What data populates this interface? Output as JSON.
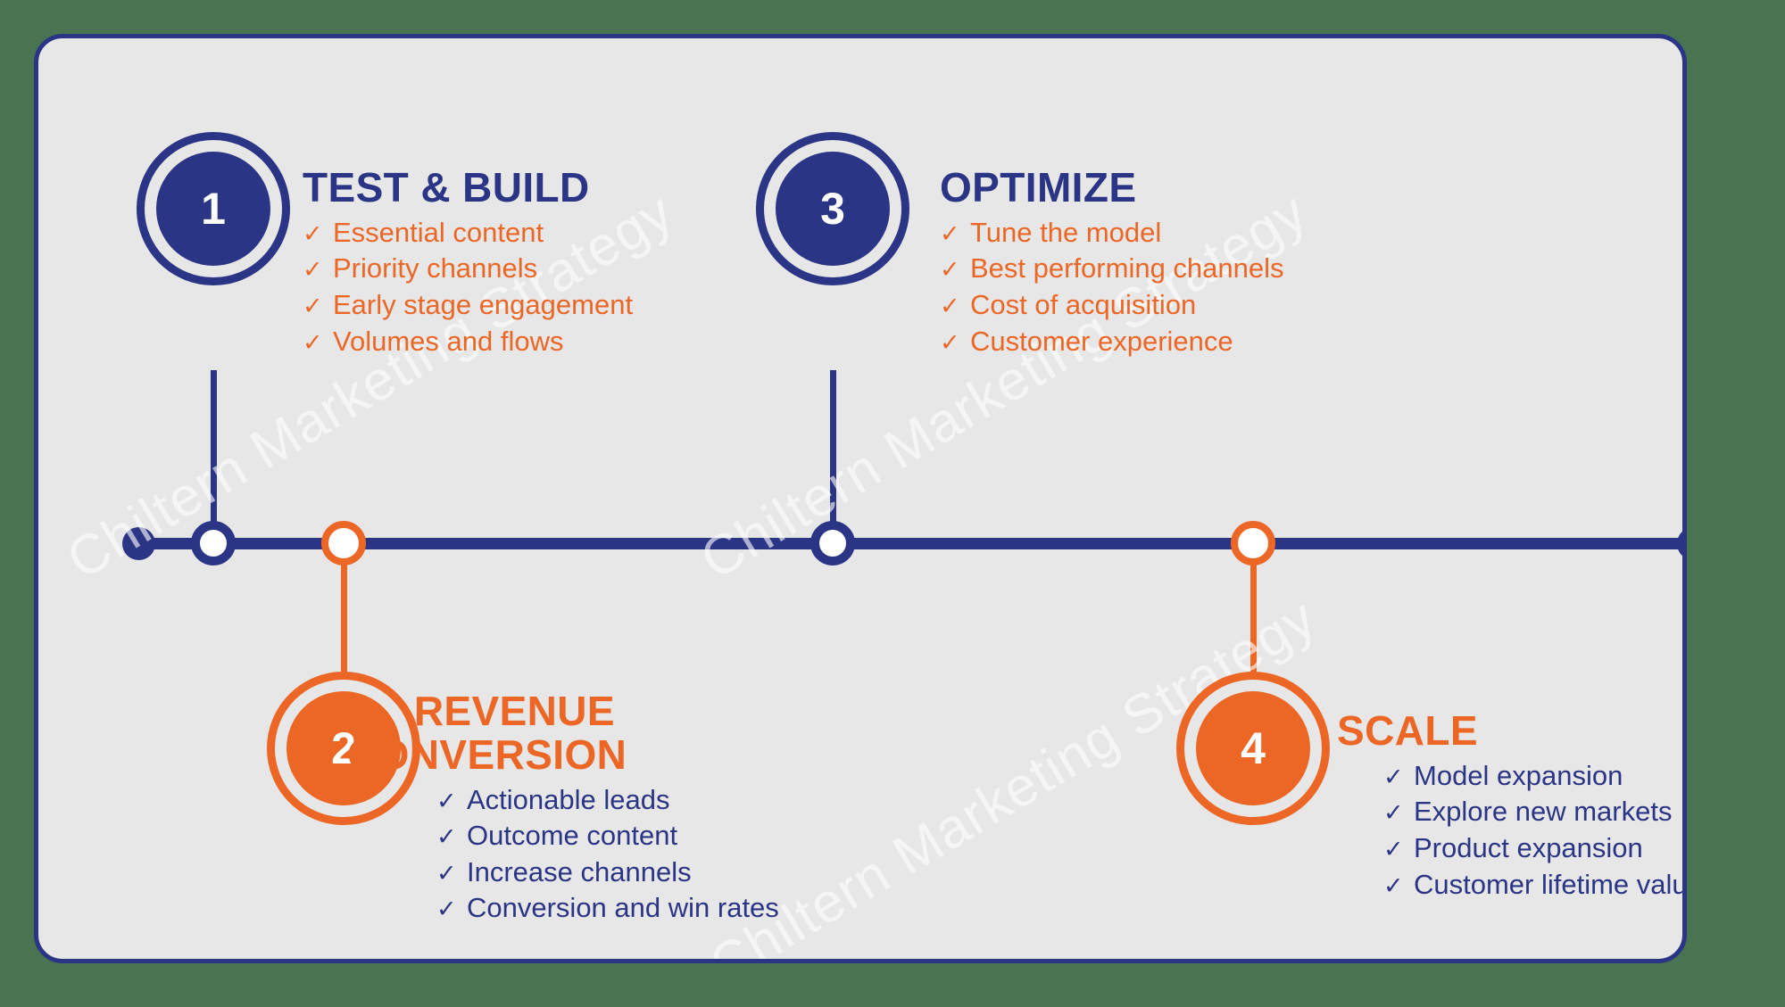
{
  "theme": {
    "page_background": "#4a7351",
    "card_background": "#e7e7e7",
    "navy": "#2b3585",
    "orange": "#ec6726",
    "white": "#ffffff"
  },
  "watermark": {
    "text": "Chiltern Marketing Strategy",
    "repeats": 3
  },
  "timeline": {
    "tick_glyph": "✓",
    "steps": [
      {
        "number": "1",
        "title": "TEST & BUILD",
        "color": "navy",
        "position": "above",
        "bullets": [
          "Essential content",
          "Priority channels",
          "Early stage engagement",
          "Volumes and flows"
        ]
      },
      {
        "number": "2",
        "title": "REVENUE\nCONVERSION",
        "color": "orange",
        "position": "below",
        "bullets": [
          "Actionable leads",
          "Outcome content",
          "Increase channels",
          "Conversion and win rates"
        ]
      },
      {
        "number": "3",
        "title": "OPTIMIZE",
        "color": "navy",
        "position": "above",
        "bullets": [
          "Tune the model",
          "Best performing channels",
          "Cost of acquisition",
          "Customer experience"
        ]
      },
      {
        "number": "4",
        "title": "SCALE",
        "color": "orange",
        "position": "below",
        "bullets": [
          "Model expansion",
          "Explore new markets",
          "Product expansion",
          "Customer lifetime value"
        ]
      }
    ]
  }
}
